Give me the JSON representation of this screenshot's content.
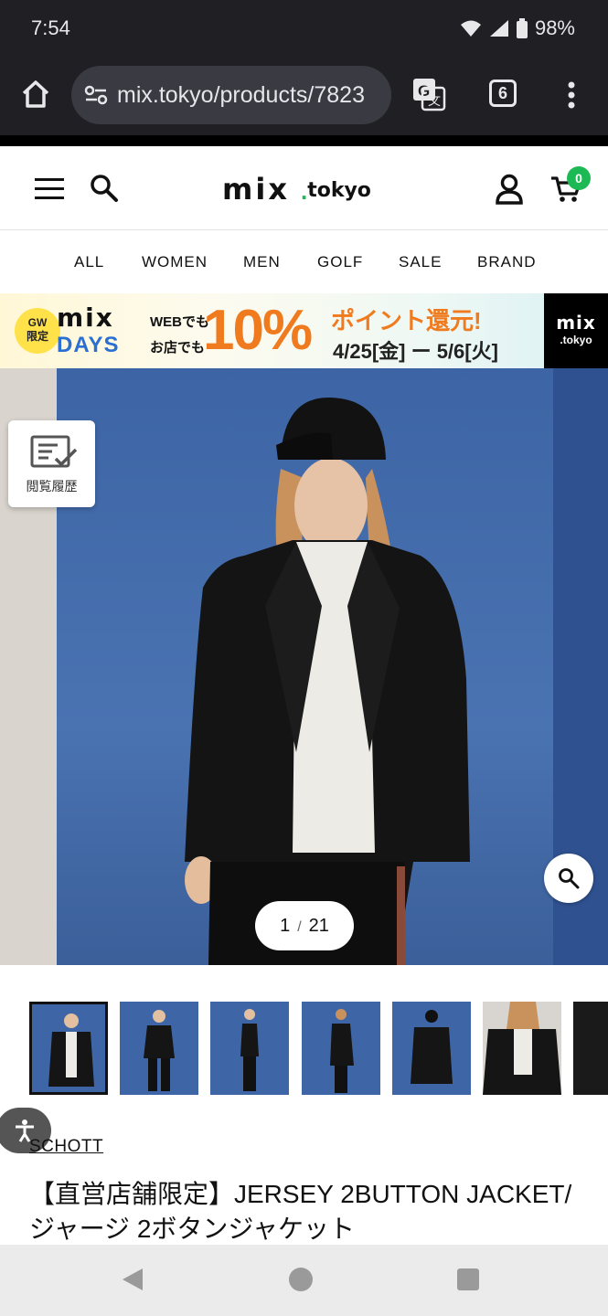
{
  "status_bar": {
    "time": "7:54",
    "battery": "98%"
  },
  "browser": {
    "url": "mix.tokyo/products/7823",
    "tab_count": "6"
  },
  "header": {
    "logo_main": "mix",
    "logo_suffix": "tokyo",
    "cart_count": "0"
  },
  "category_nav": [
    "ALL",
    "WOMEN",
    "MEN",
    "GOLF",
    "SALE",
    "BRAND"
  ],
  "banner": {
    "gw_badge_line1": "GW",
    "gw_badge_line2": "限定",
    "title_mix": "mix",
    "title_days": "DAYS",
    "web_label": "WEBでも",
    "store_label": "お店でも",
    "percent": "10%",
    "points_text": "ポイント還元!",
    "dates": "4/25[金] ー 5/6[火]",
    "logo_main": "mix",
    "logo_sub": ".tokyo"
  },
  "hero": {
    "history_label": "閲覧履歴",
    "current_image": "1",
    "total_images": "21",
    "separator": "/"
  },
  "product": {
    "brand": "SCHOTT",
    "title": "【直営店舗限定】JERSEY 2BUTTON JACKET/ジャージ 2ボタンジャケット"
  },
  "icons": {
    "home": "home-icon",
    "site_settings": "site-settings-icon",
    "translate": "translate-icon",
    "tabs": "tabs-icon",
    "more": "more-vert-icon",
    "menu": "hamburger-menu-icon",
    "search": "search-icon",
    "account": "user-icon",
    "cart": "cart-icon",
    "history": "history-icon",
    "zoom": "zoom-icon",
    "accessibility": "accessibility-icon",
    "back": "back-triangle-icon",
    "home_nav": "home-circle-icon",
    "recents": "recents-square-icon"
  },
  "colors": {
    "accent_green": "#1db954",
    "banner_orange": "#f07b1f",
    "hero_blue": "#3e66a6"
  }
}
